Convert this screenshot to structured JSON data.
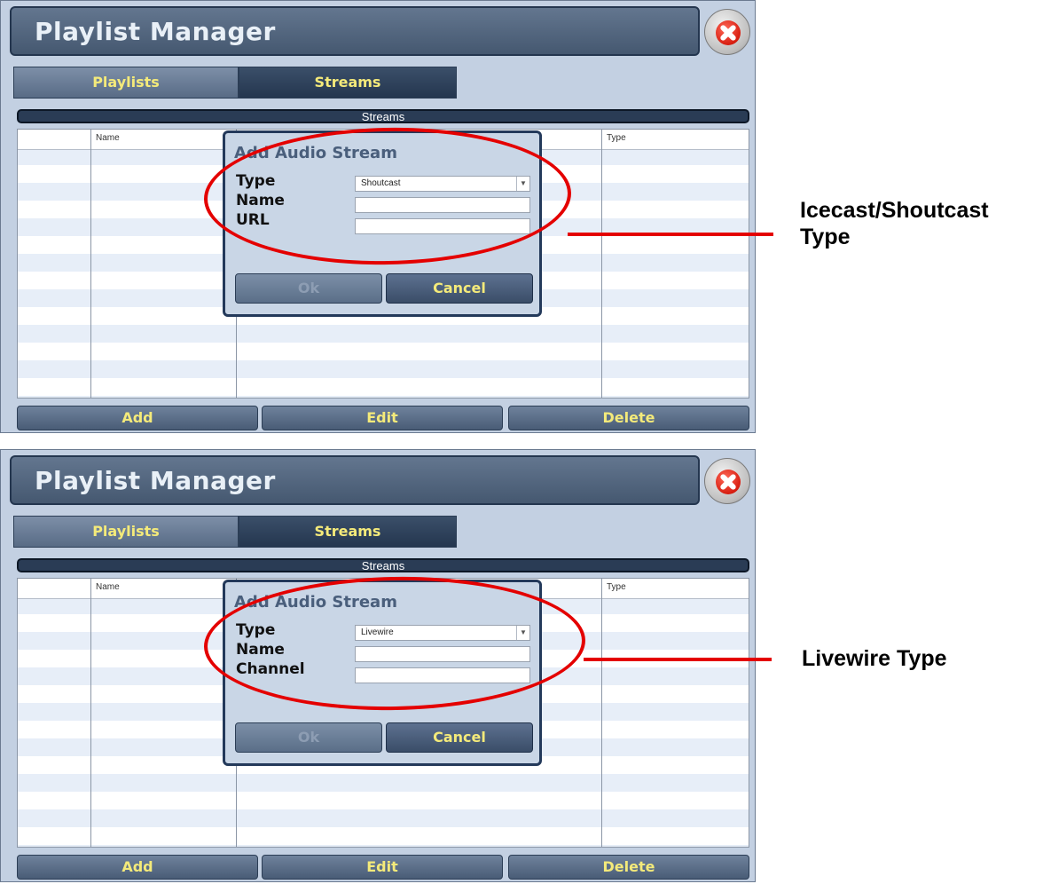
{
  "panels": [
    {
      "window_title": "Playlist Manager",
      "tabs": [
        {
          "label": "Playlists"
        },
        {
          "label": "Streams"
        }
      ],
      "active_tab": "Streams",
      "section_header": "Streams",
      "table": {
        "columns": [
          "",
          "Name",
          "",
          "Type"
        ],
        "rows": []
      },
      "buttons": {
        "add": "Add",
        "edit": "Edit",
        "delete": "Delete"
      },
      "dialog": {
        "title": "Add Audio Stream",
        "fields": [
          {
            "label": "Type",
            "control": "dropdown",
            "value": "Shoutcast"
          },
          {
            "label": "Name",
            "control": "text",
            "value": ""
          },
          {
            "label": "URL",
            "control": "text",
            "value": ""
          }
        ],
        "ok_label": "Ok",
        "cancel_label": "Cancel"
      },
      "annotation": "Icecast/Shoutcast Type"
    },
    {
      "window_title": "Playlist Manager",
      "tabs": [
        {
          "label": "Playlists"
        },
        {
          "label": "Streams"
        }
      ],
      "active_tab": "Streams",
      "section_header": "Streams",
      "table": {
        "columns": [
          "",
          "Name",
          "",
          "Type"
        ],
        "rows": []
      },
      "buttons": {
        "add": "Add",
        "edit": "Edit",
        "delete": "Delete"
      },
      "dialog": {
        "title": "Add Audio Stream",
        "fields": [
          {
            "label": "Type",
            "control": "dropdown",
            "value": "Livewire"
          },
          {
            "label": "Name",
            "control": "text",
            "value": ""
          },
          {
            "label": "Channel",
            "control": "text",
            "value": ""
          }
        ],
        "ok_label": "Ok",
        "cancel_label": "Cancel"
      },
      "annotation": "Livewire Type"
    }
  ],
  "colors": {
    "highlight": "#e40000",
    "button_text": "#f4ea7a",
    "panel_bg": "#c3d0e2"
  },
  "icons": {
    "close": "close-x-icon",
    "dropdown": "chevron-down-icon"
  }
}
